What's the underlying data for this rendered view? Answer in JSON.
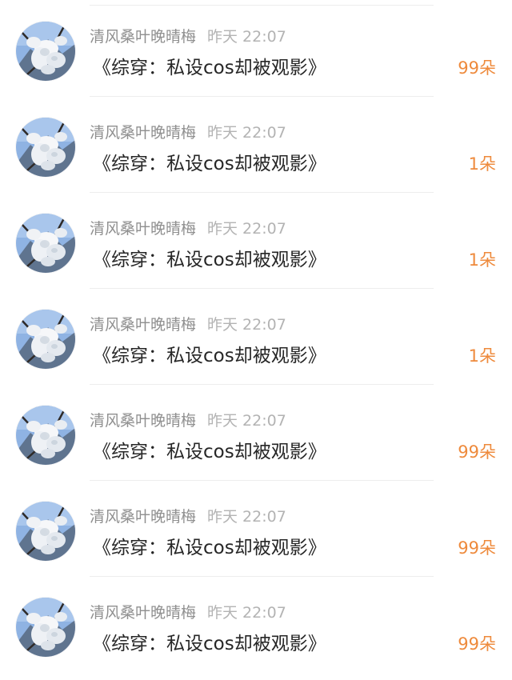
{
  "items": [
    {
      "username": "清风桑叶晚晴梅",
      "time": "昨天 22:07",
      "title": "《综穿：私设cos却被观影》",
      "gift": "99朵"
    },
    {
      "username": "清风桑叶晚晴梅",
      "time": "昨天 22:07",
      "title": "《综穿：私设cos却被观影》",
      "gift": "1朵"
    },
    {
      "username": "清风桑叶晚晴梅",
      "time": "昨天 22:07",
      "title": "《综穿：私设cos却被观影》",
      "gift": "1朵"
    },
    {
      "username": "清风桑叶晚晴梅",
      "time": "昨天 22:07",
      "title": "《综穿：私设cos却被观影》",
      "gift": "1朵"
    },
    {
      "username": "清风桑叶晚晴梅",
      "time": "昨天 22:07",
      "title": "《综穿：私设cos却被观影》",
      "gift": "99朵"
    },
    {
      "username": "清风桑叶晚晴梅",
      "time": "昨天 22:07",
      "title": "《综穿：私设cos却被观影》",
      "gift": "99朵"
    },
    {
      "username": "清风桑叶晚晴梅",
      "time": "昨天 22:07",
      "title": "《综穿：私设cos却被观影》",
      "gift": "99朵"
    }
  ],
  "colors": {
    "gift_accent": "#ee8a3c",
    "username": "#8f8f8f",
    "timestamp": "#b3b3b3",
    "title": "#262626",
    "divider": "#ededed"
  },
  "icons": {
    "avatar": "magnolia-blossom-photo"
  }
}
